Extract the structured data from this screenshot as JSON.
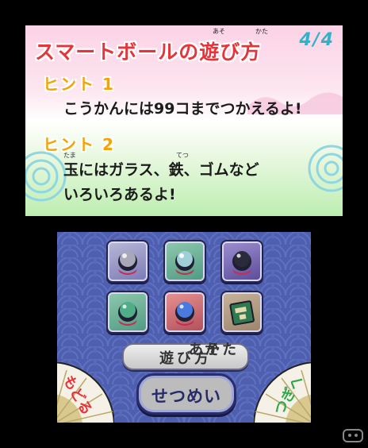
{
  "top": {
    "title": "スマートボールの遊び方",
    "title_ruby": [
      "あそ",
      "かた"
    ],
    "page_indicator": "4/4",
    "hints": [
      {
        "label": "ヒント 1",
        "lines": [
          "こうかんには99コまでつかえるよ!"
        ]
      },
      {
        "label": "ヒント 2",
        "lines": [
          "玉にはガラス、鉄、ゴムなど",
          "いろいろあるよ!"
        ]
      }
    ],
    "ruby_tama": "たま",
    "ruby_tetsu": "てつ"
  },
  "bottom": {
    "howto_label": "遊び方",
    "howto_ruby": [
      "あそ",
      "かた"
    ],
    "explain_label": "せつめい",
    "back_label": "もどる",
    "next_label": "つぎへ",
    "balls": [
      {
        "name": "gray-ball",
        "color": "#a8a8b8"
      },
      {
        "name": "glass-ball",
        "color": "#9fd0d8"
      },
      {
        "name": "black-ball",
        "color": "#2a2a3a"
      },
      {
        "name": "green-ball",
        "color": "#4fae88"
      },
      {
        "name": "blue-ball",
        "color": "#4a7ae0"
      }
    ]
  },
  "colors": {
    "title_red": "#e6353a",
    "hint_orange": "#f6a200",
    "page_teal": "#2fb3c9",
    "panel_blue": "#4f5fb0"
  }
}
